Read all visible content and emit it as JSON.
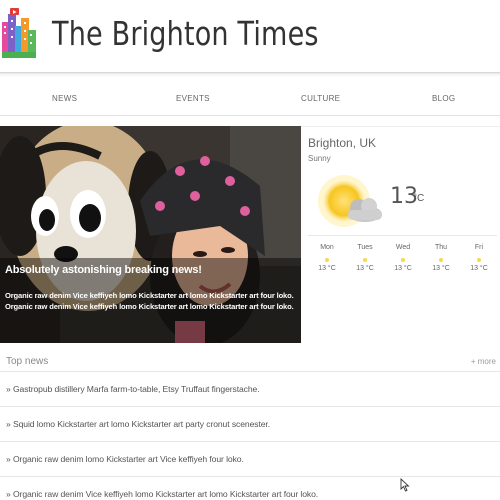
{
  "header": {
    "title": "The Brighton Times",
    "logo_icon": "city-skyline-logo-icon"
  },
  "nav": {
    "items": [
      {
        "label": "NEWS"
      },
      {
        "label": "EVENTS"
      },
      {
        "label": "CULTURE"
      },
      {
        "label": "BLOG"
      }
    ]
  },
  "hero": {
    "headline": "Absolutely astonishing breaking news!",
    "text": "Organic raw denim Vice keffiyeh lomo Kickstarter art lomo Kickstarter art four loko. Organic raw denim Vice keffiyeh lomo Kickstarter art lomo Kickstarter art four loko.",
    "image_icon": "hero-photo-image"
  },
  "weather": {
    "city": "Brighton, UK",
    "condition": "Sunny",
    "temp": "13",
    "unit": "°C",
    "icon": "sun-cloud-icon",
    "forecast": [
      {
        "day": "Mon",
        "temp": "13 °C"
      },
      {
        "day": "Tues",
        "temp": "13 °C"
      },
      {
        "day": "Wed",
        "temp": "13 °C"
      },
      {
        "day": "Thu",
        "temp": "13 °C"
      },
      {
        "day": "Fri",
        "temp": "13 °C"
      }
    ]
  },
  "top_news": {
    "title": "Top news",
    "more": "+ more",
    "items": [
      {
        "text": "» Gastropub distillery Marfa farm-to-table, Etsy Truffaut fingerstache."
      },
      {
        "text": "» Squid lomo Kickstarter art lomo Kickstarter art party cronut scenester."
      },
      {
        "text": "» Organic raw denim lomo Kickstarter art Vice keffiyeh four loko."
      },
      {
        "text": "» Organic raw denim Vice keffiyeh lomo Kickstarter art lomo Kickstarter art four loko."
      }
    ]
  },
  "colors": {
    "sun": "#f7c51f",
    "forecast_dot": "#f7d84c",
    "accent_text": "#555555"
  }
}
